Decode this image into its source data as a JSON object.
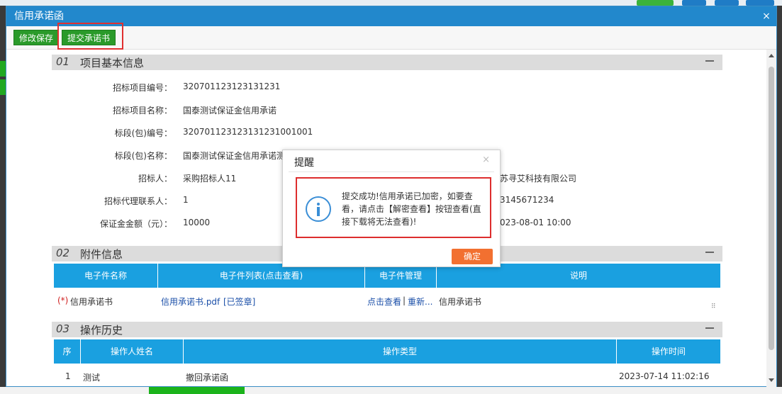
{
  "dialog": {
    "title": "信用承诺函",
    "close_glyph": "×"
  },
  "toolbar": {
    "edit_save_label": "修改保存",
    "submit_label": "提交承诺书"
  },
  "section1": {
    "num": "01",
    "title": "项目基本信息",
    "fields": [
      {
        "label": "招标项目编号：",
        "value": "320701123123131231"
      },
      {
        "label": "招标项目名称：",
        "value": "国泰测试保证金信用承诺"
      },
      {
        "label": "标段(包)编号：",
        "value": "3207011231231312310010​01"
      },
      {
        "label": "标段(包)名称：",
        "value": "国泰测试保证金信用承诺测"
      },
      {
        "label": "招标人：",
        "value": "采购招标人11"
      },
      {
        "label": "招标代理联系人：",
        "value": "1"
      },
      {
        "label": "保证金金额（元）：",
        "value": "10000"
      }
    ],
    "right_values": [
      "苏寻艾科技有限公司",
      "3145671234",
      "023-08-01 10:00"
    ]
  },
  "section2": {
    "num": "02",
    "title": "附件信息",
    "headers": [
      "电子件名称",
      "电子件列表(点击查看)",
      "电子件管理",
      "说明"
    ],
    "row": {
      "required_mark": "(*)",
      "name": "信用承诺书",
      "file": "信用承诺书.pdf",
      "signed": "[已签章]",
      "view": "点击查看",
      "sep": "|",
      "reupload": "重新...",
      "desc": "信用承诺书"
    }
  },
  "section3": {
    "num": "03",
    "title": "操作历史",
    "headers": [
      "序",
      "操作人姓名",
      "操作类型",
      "操作时间"
    ],
    "rows": [
      {
        "seq": "1",
        "name": "测试",
        "type": "撤回承诺函",
        "time": "2023-07-14 11:02:16"
      }
    ]
  },
  "modal": {
    "title": "提醒",
    "close_glyph": "×",
    "icon": "info-icon",
    "message": "提交成功!信用承诺已加密，如要查看，请点击【解密查看】按钮查看(直接下载将无法查看)!",
    "ok_label": "确定"
  },
  "colors": {
    "title_bar": "#2288cc",
    "table_header": "#1aa0e0",
    "toolbar_button": "#2a9a2a",
    "ok_button": "#f27030",
    "highlight": "#e03030"
  }
}
